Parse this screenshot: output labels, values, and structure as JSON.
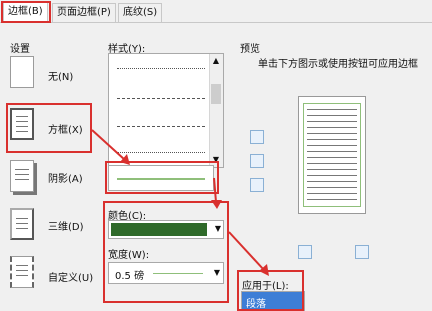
{
  "tabs": [
    {
      "label": "边框(B)"
    },
    {
      "label": "页面边框(P)"
    },
    {
      "label": "底纹(S)"
    }
  ],
  "settings": {
    "header": "设置",
    "items": [
      {
        "label": "无(N)",
        "icon": "border-none-icon"
      },
      {
        "label": "方框(X)",
        "icon": "border-box-icon"
      },
      {
        "label": "阴影(A)",
        "icon": "border-shadow-icon"
      },
      {
        "label": "三维(D)",
        "icon": "border-3d-icon"
      },
      {
        "label": "自定义(U)",
        "icon": "border-custom-icon"
      }
    ]
  },
  "style": {
    "label": "样式(Y):"
  },
  "color": {
    "label": "颜色(C):",
    "value_hex": "#2f6a2a"
  },
  "width": {
    "label": "宽度(W):",
    "value": "0.5 磅"
  },
  "preview": {
    "header": "预览",
    "instruction": "单击下方图示或使用按钮可应用边框"
  },
  "apply_to": {
    "label": "应用于(L):",
    "value": "段落"
  },
  "colors": {
    "highlight": "#d9302e",
    "border_green": "#8fbf7a"
  }
}
